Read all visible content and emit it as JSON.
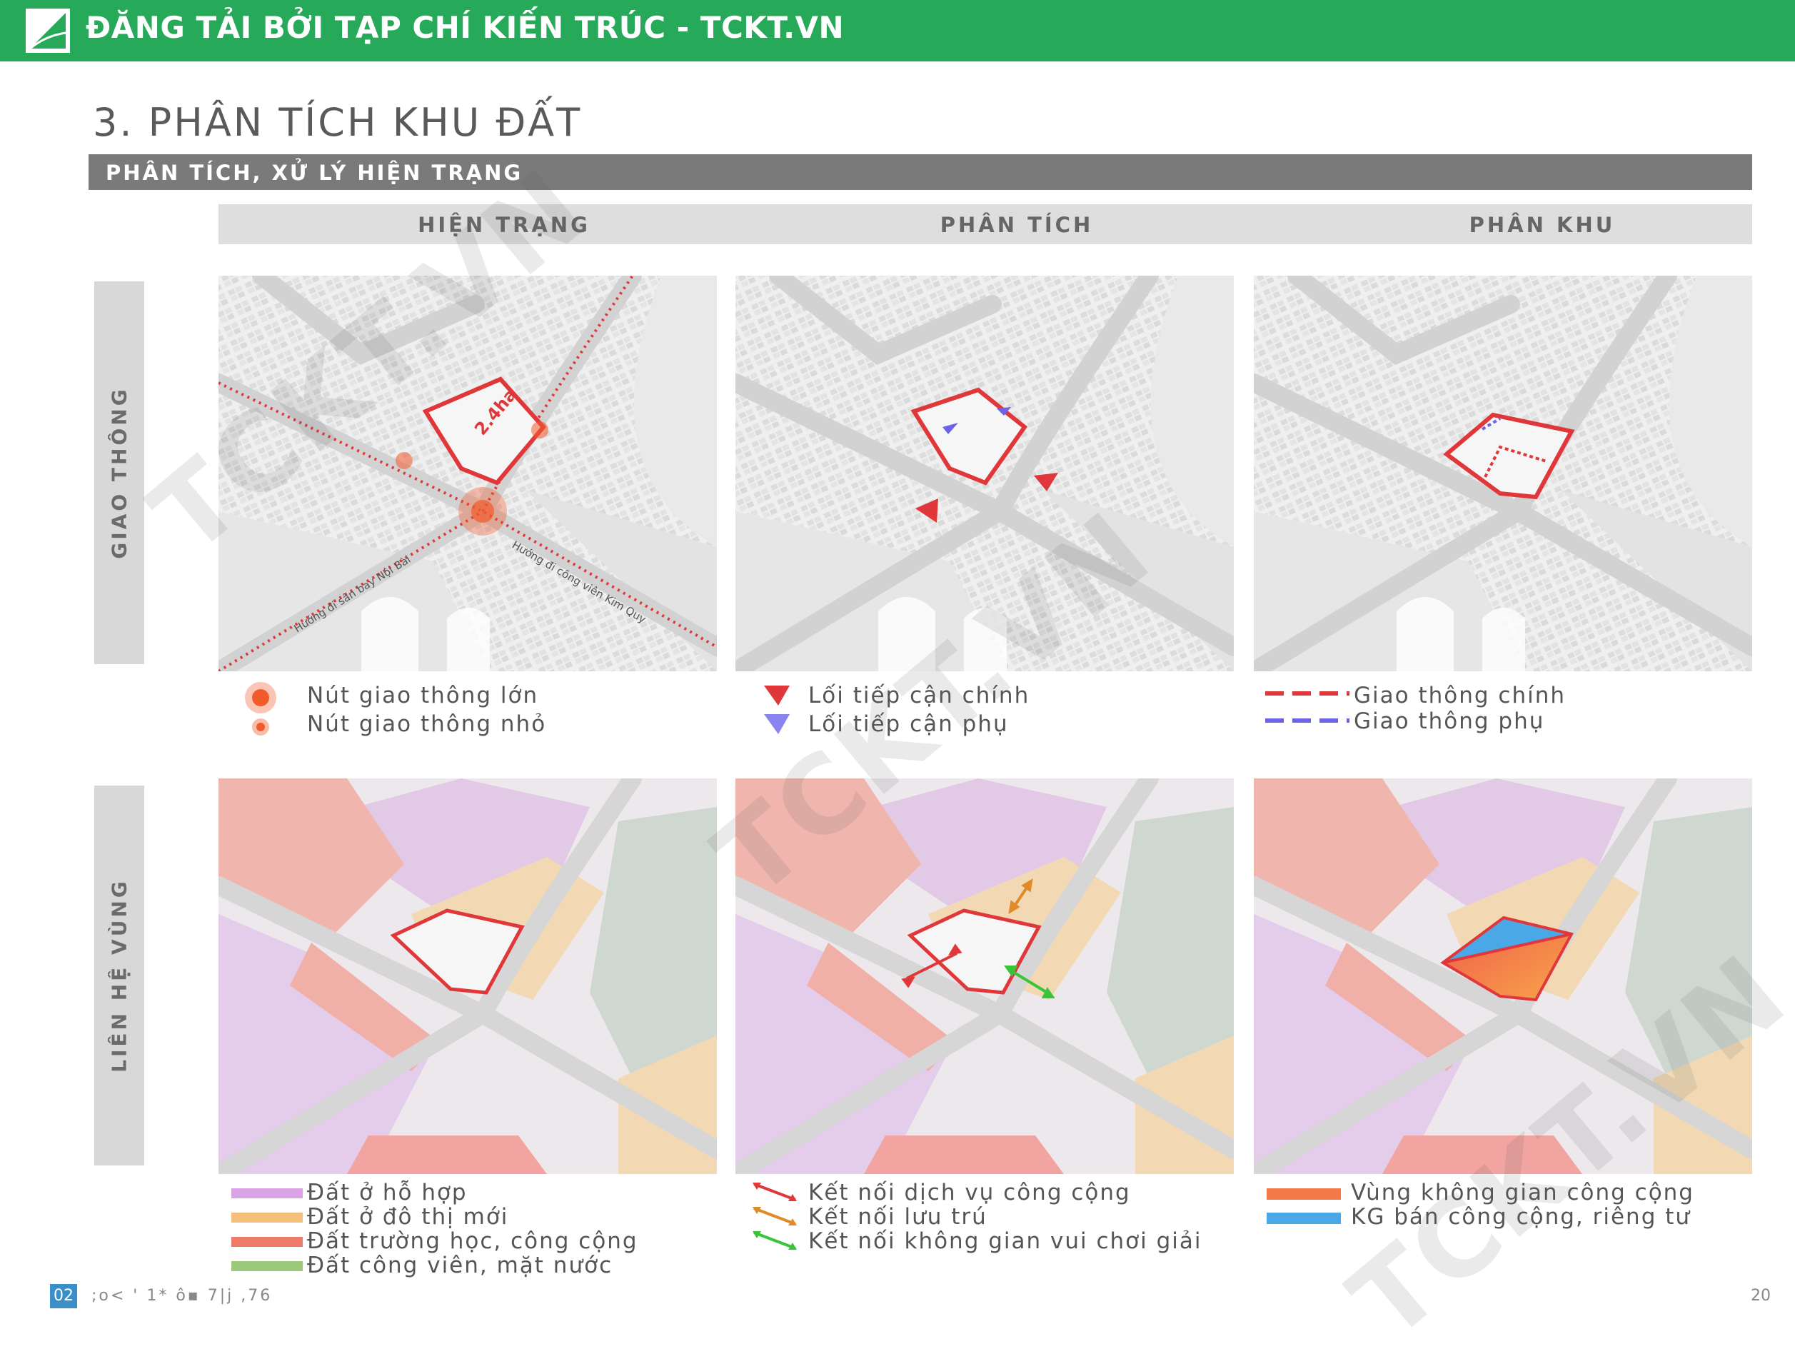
{
  "banner": {
    "text": "ĐĂNG TẢI BỞI TẠP CHÍ KIẾN TRÚC - TCKT.VN",
    "color": "#27a95a"
  },
  "page_title": "3. PHÂN TÍCH KHU ĐẤT",
  "section_title": "PHÂN TÍCH, XỬ LÝ HIỆN TRẠNG",
  "columns": [
    "HIỆN TRẠNG",
    "PHÂN TÍCH",
    "PHÂN KHU"
  ],
  "rows": [
    "GIAO THÔNG",
    "LIÊN HỆ VÙNG"
  ],
  "map_labels": {
    "area": "2.4ha",
    "road_left": "Hướng đi sân bay Nội Bài",
    "road_right": "Hướng đi công viên Kim Quy"
  },
  "legends": {
    "traffic_current": [
      "Nút giao thông lớn",
      "Nút giao thông nhỏ"
    ],
    "traffic_analysis": [
      "Lối tiếp cận chính",
      "Lối tiếp cận phụ"
    ],
    "traffic_zoning": [
      "Giao thông chính",
      "Giao thông phụ"
    ],
    "region_current": [
      "Đất ở hỗ hợp",
      "Đất ở đô thị mới",
      "Đất trường học, công cộng",
      "Đất công viên, mặt nước"
    ],
    "region_analysis": [
      "Kết nối dịch vụ công cộng",
      "Kết nối lưu trú",
      "Kết nối không gian vui chơi giải"
    ],
    "region_zoning": [
      "Vùng không gian công cộng",
      "KG bán công cộng, riêng tư"
    ]
  },
  "colors": {
    "site_outline": "#e0383a",
    "mixed_residential": "#d9a3e6",
    "new_urban": "#f2c07a",
    "school_public": "#ee7a6a",
    "park_water": "#9cc97a",
    "secondary_access": "#6b63e8",
    "connect_leisure": "#3ac43a",
    "zone_public": "#f47a4a",
    "zone_private": "#4aa8e8"
  },
  "footer": {
    "badge": "02",
    "text": ";o< ' 1* ô▪ 7|j ,76",
    "page": "20"
  },
  "watermark": "TCKT.VN"
}
